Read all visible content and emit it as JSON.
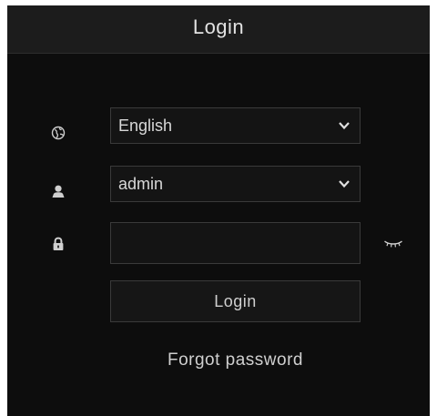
{
  "window": {
    "title": "Login"
  },
  "form": {
    "language": {
      "value": "English",
      "icon": "globe-icon"
    },
    "username": {
      "value": "admin",
      "icon": "user-icon"
    },
    "password": {
      "value": "",
      "icon": "lock-icon",
      "toggle_icon": "eye-closed-icon"
    },
    "login_label": "Login",
    "forgot_label": "Forgot password"
  },
  "colors": {
    "panel_bg": "#0d0d0d",
    "title_bar_bg": "#1c1c1c",
    "field_border": "#3a3a3a",
    "text": "#d8d8d8"
  }
}
